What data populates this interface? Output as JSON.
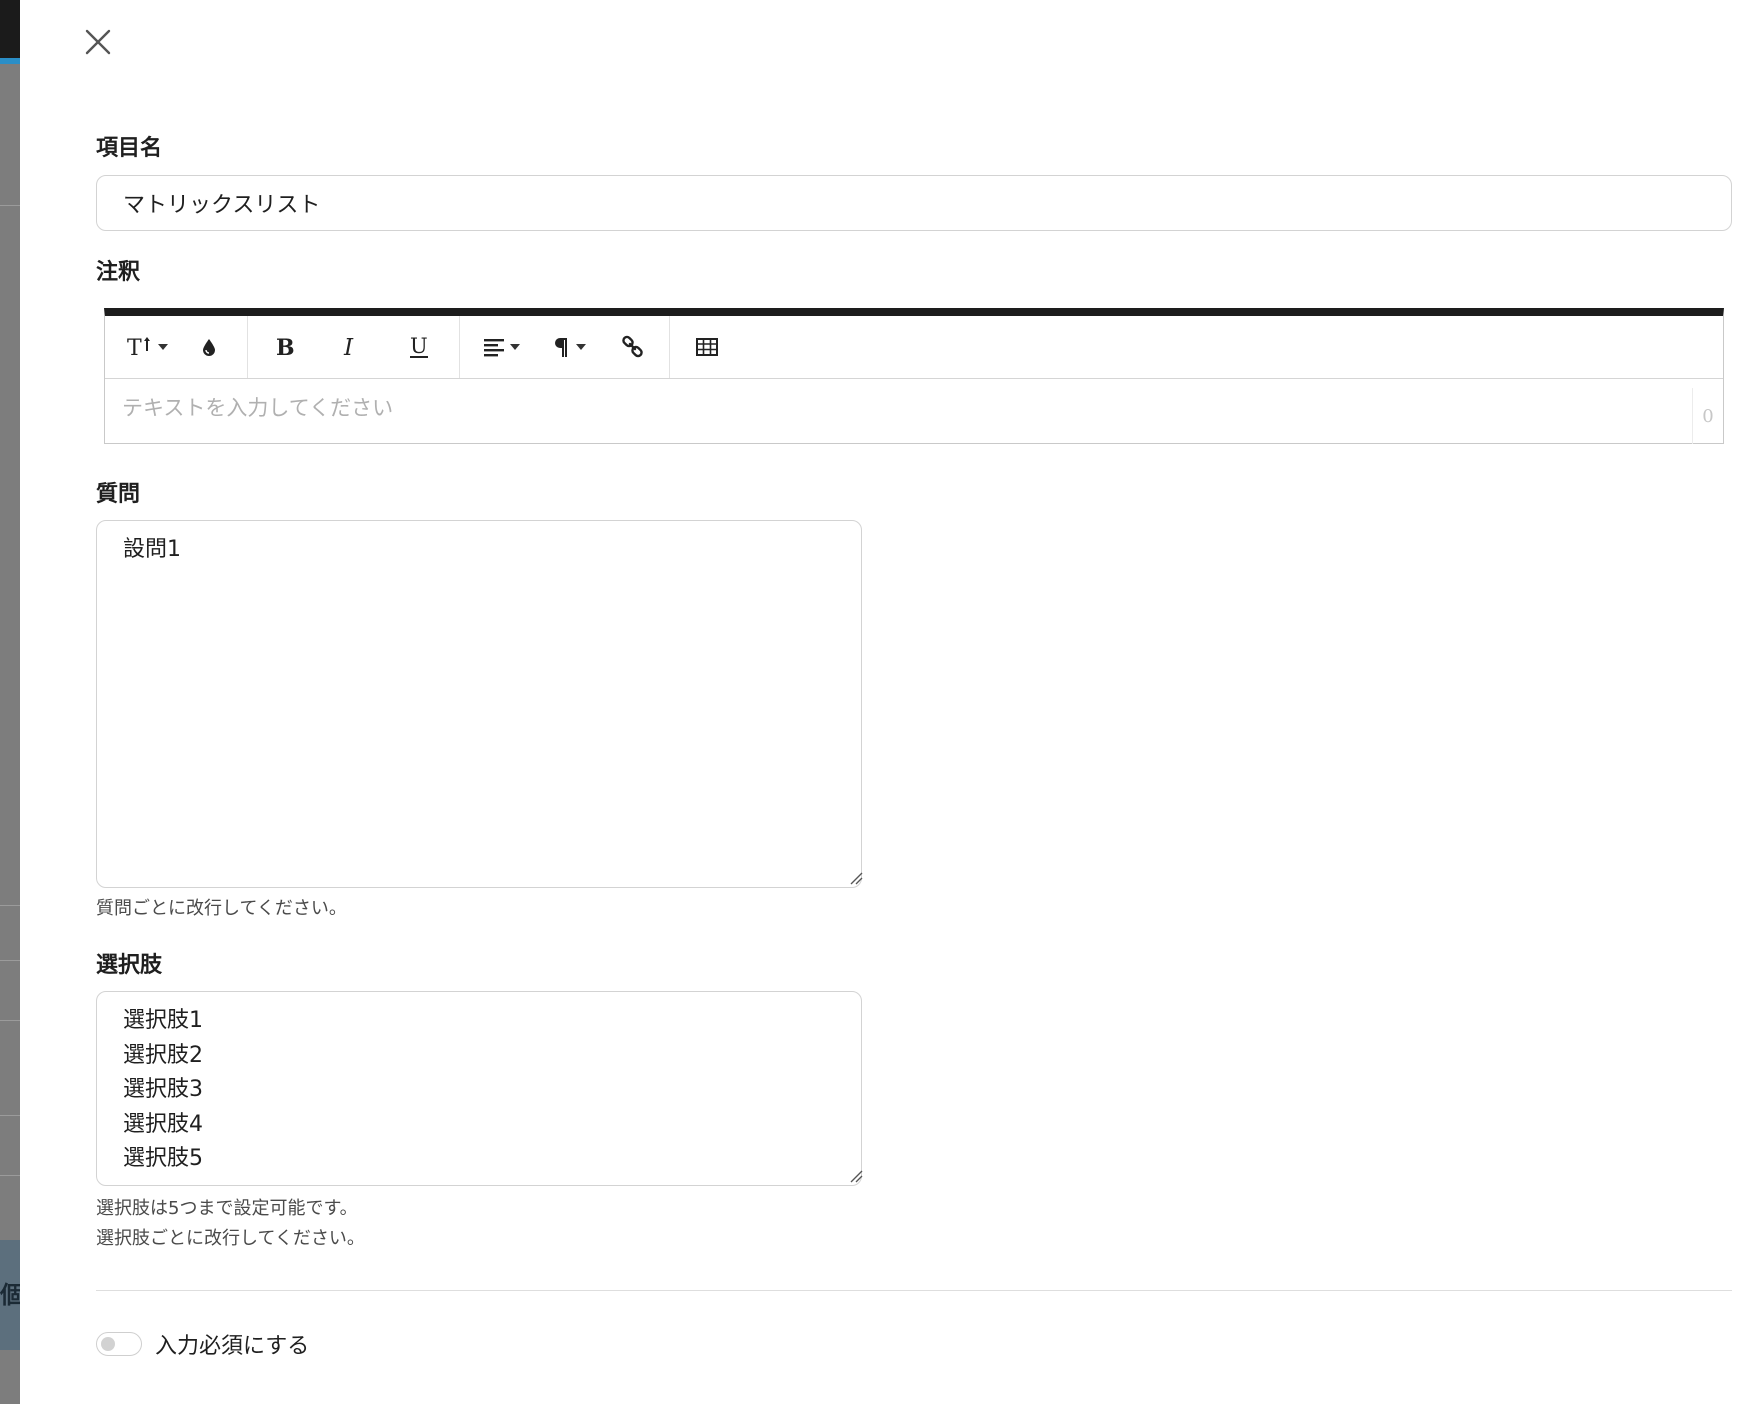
{
  "backdrop": {
    "partial_glyph": "個"
  },
  "dialog": {
    "close_icon": "close-icon"
  },
  "fields": {
    "item_name": {
      "label": "項目名",
      "value": "マトリックスリスト"
    },
    "annotation": {
      "label": "注釈",
      "placeholder": "テキストを入力してください",
      "char_count": "0",
      "toolbar": [
        {
          "name": "text-size-icon",
          "glyph": "T↕"
        },
        {
          "name": "color-drop-icon",
          "glyph": "●"
        },
        {
          "name": "bold-icon",
          "glyph": "B"
        },
        {
          "name": "italic-icon",
          "glyph": "I"
        },
        {
          "name": "underline-icon",
          "glyph": "U"
        },
        {
          "name": "align-icon",
          "glyph": "≡"
        },
        {
          "name": "paragraph-icon",
          "glyph": "¶"
        },
        {
          "name": "link-icon",
          "glyph": "link"
        },
        {
          "name": "table-icon",
          "glyph": "table"
        }
      ]
    },
    "question": {
      "label": "質問",
      "value": "設問1",
      "help": "質問ごとに改行してください。"
    },
    "choices": {
      "label": "選択肢",
      "value": "選択肢1\n選択肢2\n選択肢3\n選択肢4\n選択肢5",
      "help_1": "選択肢は5つまで設定可能です。",
      "help_2": "選択肢ごとに改行してください。"
    },
    "required": {
      "label": "入力必須にする",
      "on": false
    }
  },
  "colors": {
    "toolbar_top_border": "#1d1d1d",
    "backdrop": "#7d7d7d",
    "backdrop_accent": "#2a8ec7"
  }
}
